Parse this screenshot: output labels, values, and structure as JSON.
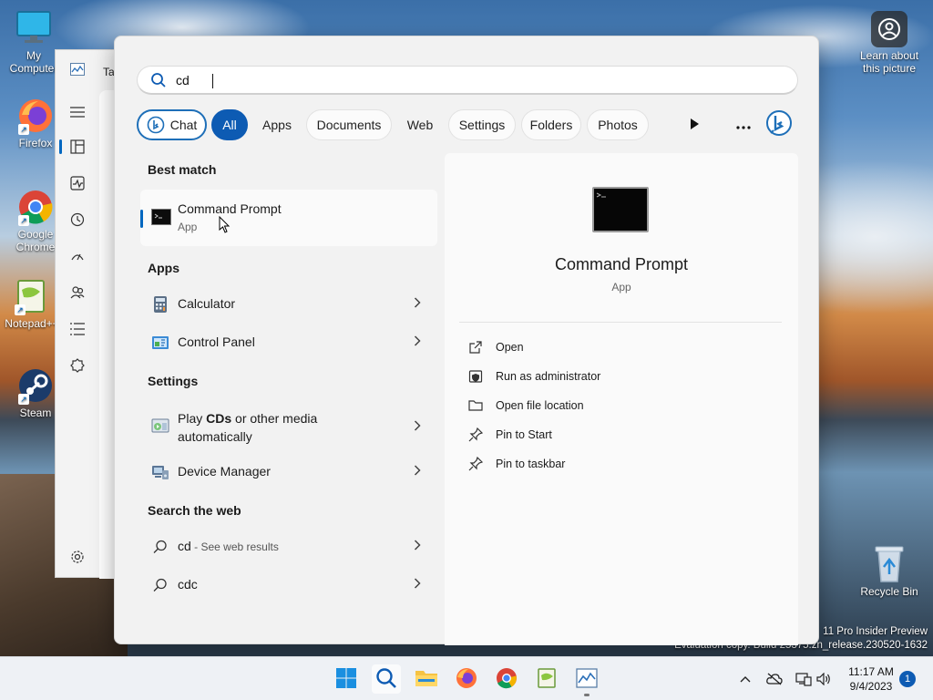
{
  "desktop": {
    "icons": [
      {
        "label": "My Computer"
      },
      {
        "label": "Firefox"
      },
      {
        "label": "Google Chrome"
      },
      {
        "label": "Notepad++"
      },
      {
        "label": "Steam"
      }
    ],
    "learn_label": "Learn about this picture",
    "recycle_label": "Recycle Bin",
    "watermark_line1": "11 Pro Insider Preview",
    "watermark_line2": "Evaluation copy. Build 25375.zn_release.230520-1632"
  },
  "bg_window": {
    "title": "Ta"
  },
  "search": {
    "query": "cd",
    "filters": [
      "Chat",
      "All",
      "Apps",
      "Documents",
      "Web",
      "Settings",
      "Folders",
      "Photos"
    ],
    "active_filter": "All"
  },
  "results": {
    "best_match_title": "Best match",
    "best_match": {
      "name": "Command Prompt",
      "type": "App"
    },
    "apps_title": "Apps",
    "apps": [
      {
        "name": "Calculator",
        "icon": "calculator-icon"
      },
      {
        "name": "Control Panel",
        "icon": "control-panel-icon"
      }
    ],
    "settings_title": "Settings",
    "settings": [
      {
        "name_prefix": "Play ",
        "name_bold": "CDs",
        "name_suffix": " or other media",
        "name_line2": "automatically",
        "icon": "autoplay-icon"
      },
      {
        "name": "Device Manager",
        "icon": "device-manager-icon"
      }
    ],
    "web_title": "Search the web",
    "web": [
      {
        "query": "cd",
        "hint": " - See web results"
      },
      {
        "query": "cdc",
        "hint": ""
      }
    ]
  },
  "preview": {
    "title": "Command Prompt",
    "subtitle": "App",
    "actions": [
      "Open",
      "Run as administrator",
      "Open file location",
      "Pin to Start",
      "Pin to taskbar"
    ]
  },
  "taskbar": {
    "time": "11:17 AM",
    "date": "9/4/2023",
    "notifications": "1"
  },
  "colors": {
    "accent": "#0d5bb3",
    "panel_bg": "#f2f2f2"
  }
}
